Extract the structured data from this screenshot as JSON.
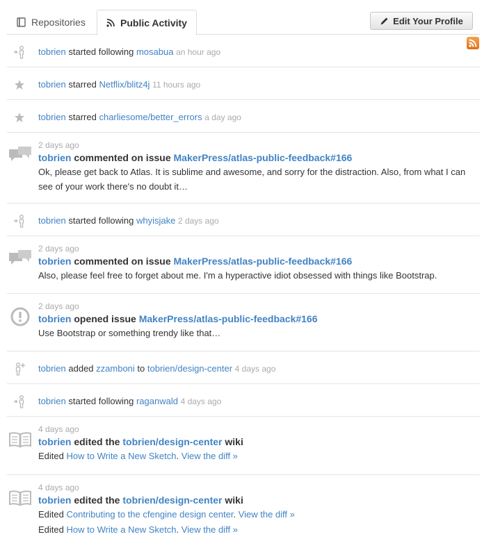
{
  "tabs": {
    "repositories": "Repositories",
    "public_activity": "Public Activity"
  },
  "edit_profile": "Edit Your Profile",
  "colors": {
    "link": "#4183c4",
    "muted": "#aaaaaa",
    "rss": "#e8781c"
  },
  "feed": {
    "r1": {
      "user": "tobrien",
      "verb": "started following",
      "target": "mosabua",
      "time": "an hour ago",
      "icon": "follow-icon"
    },
    "r2": {
      "user": "tobrien",
      "verb": "starred",
      "target": "Netflix/blitz4j",
      "time": "11 hours ago",
      "icon": "star-icon"
    },
    "r3": {
      "user": "tobrien",
      "verb": "starred",
      "target": "charliesome/better_errors",
      "time": "a day ago",
      "icon": "star-icon"
    },
    "r4": {
      "time": "2 days ago",
      "user": "tobrien",
      "verb": "commented on issue",
      "target": "MakerPress/atlas-public-feedback#166",
      "text": "Ok, please get back to Atlas. It is sublime and awesome, and sorry for the distraction. Also, from what I can see of your work there's no doubt it…",
      "icon": "comment-icon"
    },
    "r5": {
      "user": "tobrien",
      "verb": "started following",
      "target": "whyisjake",
      "time": "2 days ago",
      "icon": "follow-icon"
    },
    "r6": {
      "time": "2 days ago",
      "user": "tobrien",
      "verb": "commented on issue",
      "target": "MakerPress/atlas-public-feedback#166",
      "text": "Also, please feel free to forget about me. I'm a hyperactive idiot obsessed with things like Bootstrap.",
      "icon": "comment-icon"
    },
    "r7": {
      "time": "2 days ago",
      "user": "tobrien",
      "verb": "opened issue",
      "target": "MakerPress/atlas-public-feedback#166",
      "text": "Use Bootstrap or something trendy like that…",
      "icon": "issue-opened-icon"
    },
    "r8": {
      "user": "tobrien",
      "verb": "added",
      "member": "zzamboni",
      "to": "to",
      "target": "tobrien/design-center",
      "time": "4 days ago",
      "icon": "member-added-icon"
    },
    "r9": {
      "user": "tobrien",
      "verb": "started following",
      "target": "raganwald",
      "time": "4 days ago",
      "icon": "follow-icon"
    },
    "r10": {
      "time": "4 days ago",
      "user": "tobrien",
      "verb": "edited the",
      "target": "tobrien/design-center",
      "suffix": "wiki",
      "edited": "Edited",
      "page1": "How to Write a New Sketch",
      "diff": "View the diff »",
      "icon": "wiki-icon"
    },
    "r11": {
      "time": "4 days ago",
      "user": "tobrien",
      "verb": "edited the",
      "target": "tobrien/design-center",
      "suffix": "wiki",
      "edited": "Edited",
      "page1": "Contributing to the cfengine design center",
      "page2": "How to Write a New Sketch",
      "diff": "View the diff »",
      "icon": "wiki-icon"
    }
  }
}
